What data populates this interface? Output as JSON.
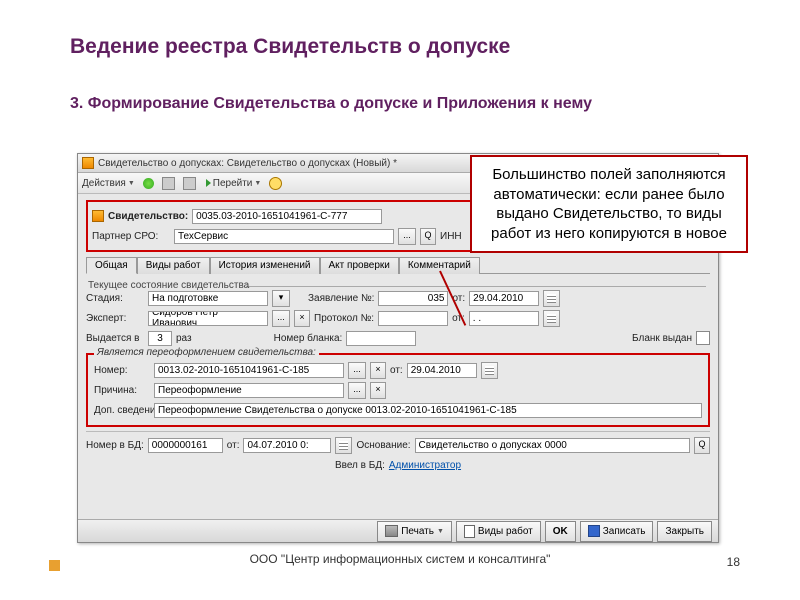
{
  "heading": "Ведение реестра Свидетельств о допуске",
  "subheading": "3. Формирование Свидетельства о допуске и Приложения к нему",
  "footer_company": "ООО \"Центр информационных систем и консалтинга\"",
  "page_number": "18",
  "callout_text": "Большинство полей заполняются автоматически: если ранее было выдано Свидетельство, то виды работ из него копируются в новое",
  "window": {
    "title": "Свидетельство о допусках: Свидетельство о допусках (Новый) *",
    "toolbar": {
      "actions": "Действия",
      "goto": "Перейти"
    },
    "cert_row": {
      "icon_label": "Свидетельство:",
      "value": "0035.03-2010-1651041961-С-777"
    },
    "partner_row": {
      "label": "Партнер СРО:",
      "value": "ТехСервис",
      "inn_label": "ИНН"
    },
    "tabs": [
      "Общая",
      "Виды работ",
      "История изменений",
      "Акт проверки",
      "Комментарий"
    ],
    "status_title": "Текущее состояние свидетельства",
    "stage": {
      "label": "Стадия:",
      "value": "На подготовке",
      "app_label": "Заявление №:",
      "app_value": "035",
      "ot": "от:",
      "date": "29.04.2010"
    },
    "expert": {
      "label": "Эксперт:",
      "value": "Сидоров Петр Иванович",
      "proto_label": "Протокол №:",
      "proto_value": "",
      "ot": "от:",
      "date": ". ."
    },
    "issued": {
      "label": "Выдается в",
      "value": "3",
      "suffix": "раз",
      "blank_label": "Номер бланка:",
      "blank_value": "",
      "issued_label": "Бланк выдан"
    },
    "reissue": {
      "legend": "Является переоформлением свидетельства:",
      "number_label": "Номер:",
      "number": "0013.02-2010-1651041961-С-185",
      "ot": "от:",
      "date": "29.04.2010",
      "reason_label": "Причина:",
      "reason": "Переоформление",
      "extra_label": "Доп. сведения:",
      "extra": "Переоформление Свидетельства о допуске 0013.02-2010-1651041961-С-185"
    },
    "db_row": {
      "label": "Номер в БД:",
      "value": "0000000161",
      "ot": "от:",
      "date": "04.07.2010  0:",
      "osn_label": "Основание:",
      "osn_value": "Свидетельство о допусках 0000"
    },
    "entered": {
      "label": "Ввел в БД:",
      "user": "Администратор"
    },
    "buttons": {
      "print": "Печать",
      "works": "Виды работ",
      "ok": "OK",
      "save": "Записать",
      "close": "Закрыть"
    }
  }
}
